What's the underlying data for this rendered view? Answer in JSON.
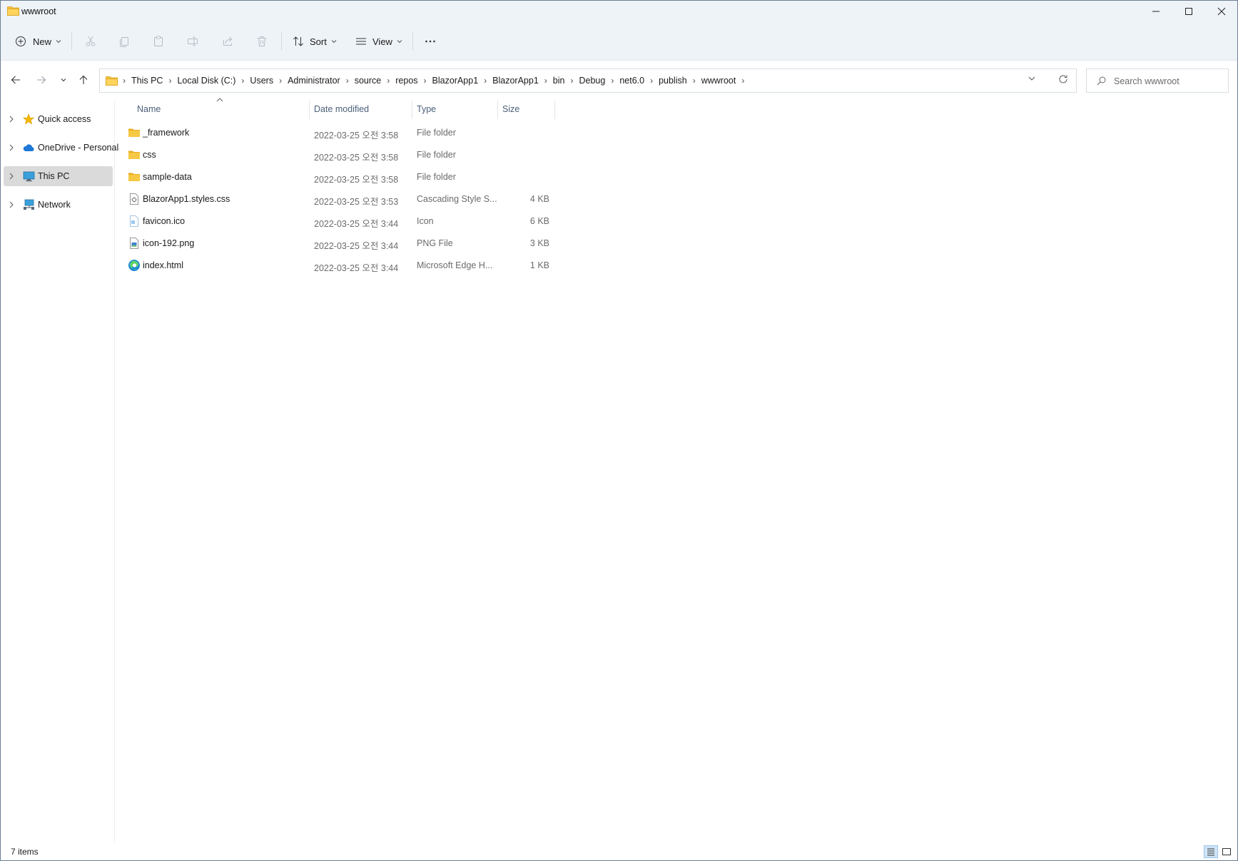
{
  "window": {
    "title": "wwwroot",
    "minimize_icon": "minimize-icon",
    "maximize_icon": "maximize-icon",
    "close_icon": "close-icon"
  },
  "toolbar": {
    "new_label": "New",
    "sort_label": "Sort",
    "view_label": "View",
    "more_icon": "more-icon",
    "icons": [
      "cut-icon",
      "copy-icon",
      "paste-icon",
      "rename-icon",
      "share-icon",
      "delete-icon"
    ]
  },
  "address": {
    "crumbs": [
      "This PC",
      "Local Disk (C:)",
      "Users",
      "Administrator",
      "source",
      "repos",
      "BlazorApp1",
      "BlazorApp1",
      "bin",
      "Debug",
      "net6.0",
      "publish",
      "wwwroot"
    ]
  },
  "search": {
    "placeholder": "Search wwwroot"
  },
  "sidebar": {
    "items": [
      {
        "label": "Quick access",
        "icon": "star-icon"
      },
      {
        "label": "OneDrive - Personal",
        "icon": "cloud-icon"
      },
      {
        "label": "This PC",
        "icon": "computer-icon",
        "selected": true
      },
      {
        "label": "Network",
        "icon": "network-icon"
      }
    ]
  },
  "columns": {
    "name": "Name",
    "date": "Date modified",
    "type": "Type",
    "size": "Size"
  },
  "files": [
    {
      "name": "_framework",
      "date": "2022-03-25 오전 3:58",
      "type": "File folder",
      "size": "",
      "icon": "folder-icon"
    },
    {
      "name": "css",
      "date": "2022-03-25 오전 3:58",
      "type": "File folder",
      "size": "",
      "icon": "folder-icon"
    },
    {
      "name": "sample-data",
      "date": "2022-03-25 오전 3:58",
      "type": "File folder",
      "size": "",
      "icon": "folder-icon"
    },
    {
      "name": "BlazorApp1.styles.css",
      "date": "2022-03-25 오전 3:53",
      "type": "Cascading Style S...",
      "size": "4 KB",
      "icon": "css-file-icon"
    },
    {
      "name": "favicon.ico",
      "date": "2022-03-25 오전 3:44",
      "type": "Icon",
      "size": "6 KB",
      "icon": "ico-file-icon"
    },
    {
      "name": "icon-192.png",
      "date": "2022-03-25 오전 3:44",
      "type": "PNG File",
      "size": "3 KB",
      "icon": "png-file-icon"
    },
    {
      "name": "index.html",
      "date": "2022-03-25 오전 3:44",
      "type": "Microsoft Edge H...",
      "size": "1 KB",
      "icon": "edge-icon"
    }
  ],
  "status": {
    "count": "7 items"
  },
  "colors": {
    "folder": "#f5c242",
    "chrome": "#eef3f8",
    "selected": "#dadada",
    "header_text": "#4c607a",
    "accent": "#0067c0"
  }
}
